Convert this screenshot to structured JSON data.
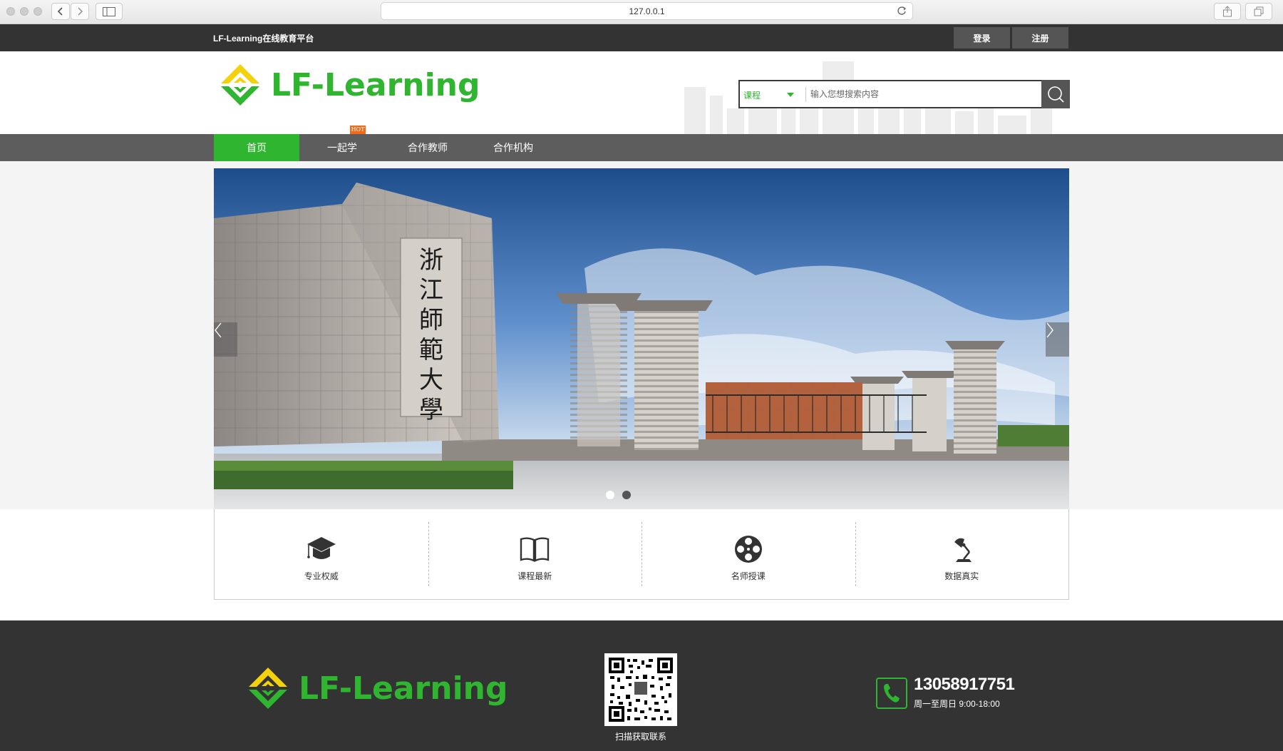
{
  "browser": {
    "address": "127.0.0.1"
  },
  "topbar": {
    "site_name": "LF-Learning在线教育平台",
    "login_label": "登录",
    "register_label": "注册"
  },
  "header": {
    "logo_text": "LF-Learning",
    "search": {
      "category": "课程",
      "placeholder": "输入您想搜索内容"
    }
  },
  "nav": {
    "items": [
      "首页",
      "一起学",
      "合作教师",
      "合作机构"
    ],
    "active_index": 0,
    "hot_badge": "HOT"
  },
  "banner": {
    "sign_chars": [
      "浙",
      "江",
      "師",
      "範",
      "大",
      "學"
    ],
    "slide_count": 2,
    "active_slide": 0
  },
  "features": [
    {
      "label": "专业权威",
      "icon": "graduation-cap-icon"
    },
    {
      "label": "课程最新",
      "icon": "open-book-icon"
    },
    {
      "label": "名师授课",
      "icon": "film-reel-icon"
    },
    {
      "label": "数据真实",
      "icon": "desk-lamp-icon"
    }
  ],
  "footer": {
    "logo_text": "LF-Learning",
    "qr_label": "扫描获取联系",
    "phone": "13058917751",
    "hours": "周一至周日 9:00-18:00"
  },
  "colors": {
    "brand_green": "#2fb52f",
    "logo_yellow": "#f4d20b",
    "dark": "#333333",
    "nav_gray": "#5d5d5d",
    "hot_orange": "#f26a1b"
  }
}
